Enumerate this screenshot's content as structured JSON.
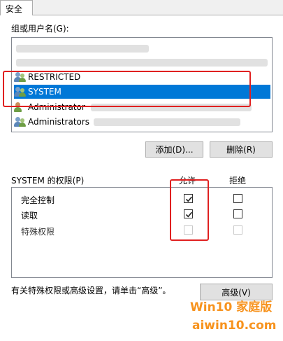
{
  "tab": {
    "label": "安全"
  },
  "groups": {
    "label": "组或用户名(G):",
    "items": [
      {
        "name": "RESTRICTED",
        "selected": false
      },
      {
        "name": "SYSTEM",
        "selected": true
      },
      {
        "name": "Administrator",
        "selected": false
      },
      {
        "name": "Administrators",
        "selected": false
      }
    ]
  },
  "buttons": {
    "add": "添加(D)...",
    "remove": "删除(R)",
    "advanced": "高级(V)"
  },
  "permissions": {
    "label": "SYSTEM 的权限(P)",
    "allow_header": "允许",
    "deny_header": "拒绝",
    "rows": [
      {
        "name": "完全控制",
        "allow": true,
        "deny": false,
        "disabled": false
      },
      {
        "name": "读取",
        "allow": true,
        "deny": false,
        "disabled": false
      },
      {
        "name": "特殊权限",
        "allow": false,
        "deny": false,
        "disabled": true
      }
    ]
  },
  "footer_text": "有关特殊权限或高级设置，请单击“高级”。",
  "watermark": {
    "line1": "Win10 家庭版",
    "line2": "aiwin10.com"
  },
  "colors": {
    "selection": "#0078d7",
    "highlight": "#e02020",
    "watermark": "#f7931e"
  }
}
